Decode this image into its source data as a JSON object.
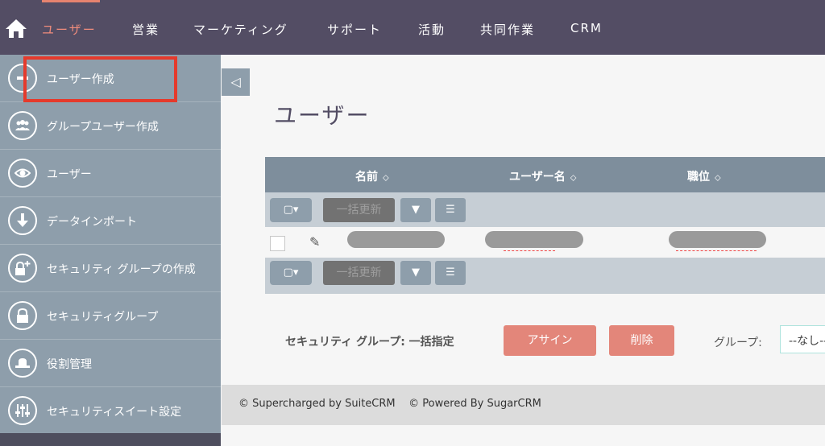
{
  "nav": {
    "home_icon": "home-icon",
    "items": [
      "ユーザー",
      "営業",
      "マーケティング",
      "サポート",
      "活動",
      "共同作業",
      "CRM"
    ],
    "accent_color": "#e6836f"
  },
  "sidebar": {
    "items": [
      {
        "label": "ユーザー作成",
        "icon": "minus-circle-icon"
      },
      {
        "label": "グループユーザー作成",
        "icon": "group-users-icon"
      },
      {
        "label": "ユーザー",
        "icon": "eye-icon"
      },
      {
        "label": "データインポート",
        "icon": "download-arrow-icon"
      },
      {
        "label": "セキュリティ グループの作成",
        "icon": "lock-plus-icon"
      },
      {
        "label": "セキュリティグループ",
        "icon": "lock-icon"
      },
      {
        "label": "役割管理",
        "icon": "hat-icon"
      },
      {
        "label": "セキュリティスイート設定",
        "icon": "sliders-icon"
      }
    ],
    "collapse_glyph": "◁"
  },
  "main": {
    "title": "ユーザー",
    "columns": [
      "名前",
      "ユーザー名",
      "職位"
    ],
    "sort_glyph": "⬦",
    "mass_update_label": "一括更新",
    "bulk_actions": {
      "label": "セキュリティ グループ: 一括指定",
      "assign": "アサイン",
      "remove": "削除",
      "group_label": "グループ:",
      "group_value": "--なし--"
    }
  },
  "footer": {
    "suitecrm": "© Supercharged by SuiteCRM",
    "sugarcrm": "© Powered By SugarCRM"
  }
}
